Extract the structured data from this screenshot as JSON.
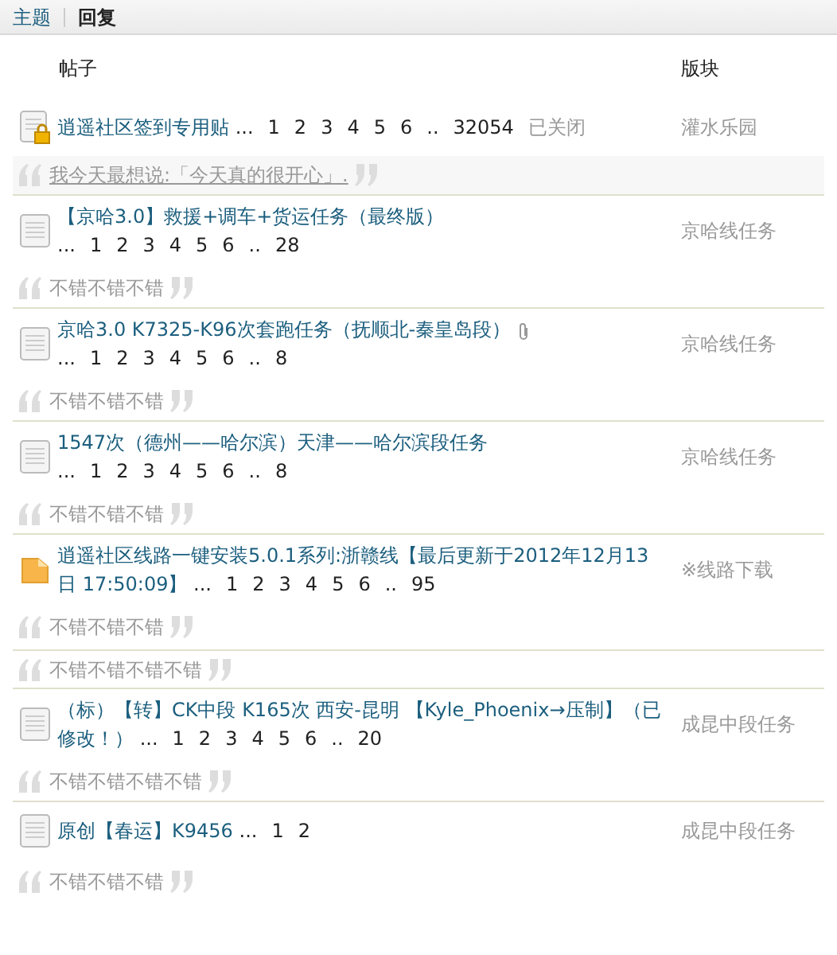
{
  "tabs": [
    {
      "label": "主题",
      "selected": false
    },
    {
      "label": "回复",
      "selected": true
    }
  ],
  "columns": {
    "post": "帖子",
    "forum": "版块"
  },
  "threads": [
    {
      "kind": "locked",
      "title": [
        "逍遥社区签到专用贴"
      ],
      "attachment": false,
      "pages": [
        "...",
        "1",
        "2",
        "3",
        "4",
        "5",
        "6",
        "..",
        "32054"
      ],
      "status": "已关闭",
      "forum": "灌水乐园",
      "quotes": [
        {
          "kind": "link",
          "text": "我今天最想说:「今天真的很开心」."
        }
      ]
    },
    {
      "kind": "normal",
      "title": [
        "【京哈3.0】救援+调车+货运任务（最终版）"
      ],
      "attachment": false,
      "pages": [
        "...",
        "1",
        "2",
        "3",
        "4",
        "5",
        "6",
        "..",
        "28"
      ],
      "forum": "京哈线任务",
      "quotes": [
        {
          "kind": "plain",
          "text": "不错不错不错"
        }
      ]
    },
    {
      "kind": "normal",
      "title": [
        "京哈3.0 K7325-K96次套跑任务（抚顺北-秦皇岛段）"
      ],
      "attachment": true,
      "pages": [
        "...",
        "1",
        "2",
        "3",
        "4",
        "5",
        "6",
        "..",
        "8"
      ],
      "forum": "京哈线任务",
      "quotes": [
        {
          "kind": "plain",
          "text": "不错不错不错"
        }
      ]
    },
    {
      "kind": "normal",
      "title": [
        "1547次（德州——哈尔滨）天津——哈尔滨段任务"
      ],
      "attachment": false,
      "pages": [
        "...",
        "1",
        "2",
        "3",
        "4",
        "5",
        "6",
        "..",
        "8"
      ],
      "forum": "京哈线任务",
      "quotes": [
        {
          "kind": "plain",
          "text": "不错不错不错"
        }
      ]
    },
    {
      "kind": "folder",
      "title": [
        "逍遥社区线路一键安装5.0.1系列:浙赣线【最后更新于2012年12月13",
        "日 17:50:09】"
      ],
      "attachment": false,
      "pages": [
        "...",
        "1",
        "2",
        "3",
        "4",
        "5",
        "6",
        "..",
        "95"
      ],
      "forum": "※线路下载",
      "quotes": [
        {
          "kind": "plain",
          "text": "不错不错不错"
        },
        {
          "kind": "plain",
          "text": "不错不错不错不错"
        }
      ]
    },
    {
      "kind": "normal",
      "title": [
        "（标）【转】CK中段 K165次 西安-昆明 【Kyle_Phoenix→压制】（已",
        "修改！）"
      ],
      "attachment": false,
      "pages": [
        "...",
        "1",
        "2",
        "3",
        "4",
        "5",
        "6",
        "..",
        "20"
      ],
      "forum": "成昆中段任务",
      "quotes": [
        {
          "kind": "plain",
          "text": "不错不错不错不错"
        }
      ]
    },
    {
      "kind": "normal",
      "title": [
        "原创【春运】K9456"
      ],
      "attachment": false,
      "pages": [
        "...",
        "1",
        "2"
      ],
      "forum": "成昆中段任务",
      "quotes": [
        {
          "kind": "plain",
          "text": "不错不错不错"
        }
      ]
    }
  ]
}
